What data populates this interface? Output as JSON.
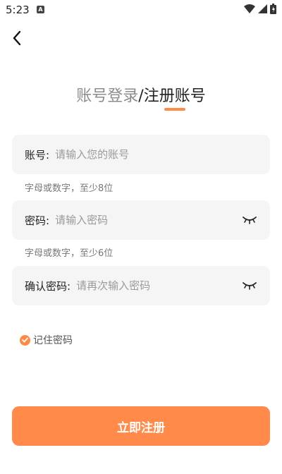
{
  "status_bar": {
    "time": "5:23",
    "notification_icon": "A",
    "icons": [
      "wifi-icon",
      "signal-icon",
      "battery-icon"
    ]
  },
  "header": {
    "back_icon": "chevron-left-icon",
    "title_login": "账号登录",
    "title_separator": "/",
    "title_register": "注册账号",
    "active_tab": "register",
    "accent_color": "#ff8a45"
  },
  "form": {
    "account": {
      "label": "账号:",
      "placeholder": "请输入您的账号",
      "value": "",
      "hint": "字母或数字，至少8位"
    },
    "password": {
      "label": "密码:",
      "placeholder": "请输入密码",
      "value": "",
      "hint": "字母或数字，至少6位",
      "toggle_icon": "eye-closed-icon"
    },
    "confirm_password": {
      "label": "确认密码:",
      "placeholder": "请再次输入密码",
      "value": "",
      "toggle_icon": "eye-closed-icon"
    },
    "remember": {
      "label": "记住密码",
      "checked": true
    }
  },
  "submit": {
    "label": "立即注册",
    "color": "#ff8a4a"
  }
}
